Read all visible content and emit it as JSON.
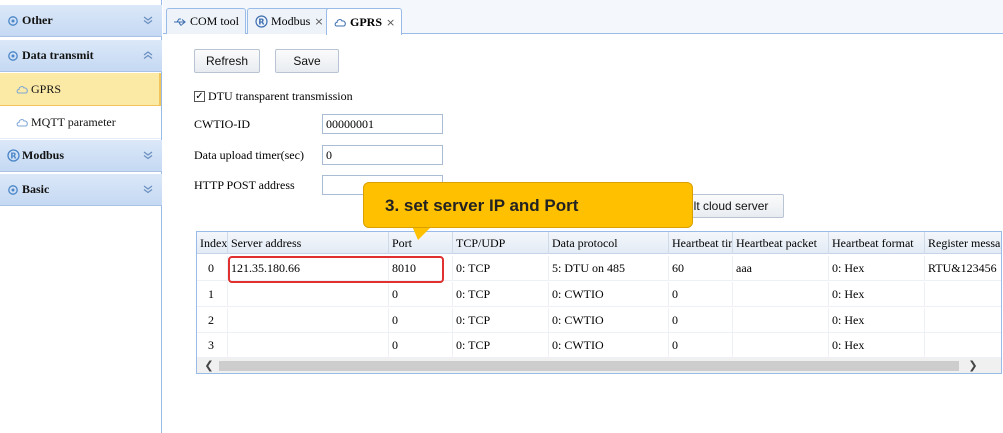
{
  "colors": {
    "sidebar_icon": "#4a86c8",
    "active_item": "#fbe9a6",
    "callout": "#ffc000",
    "highlight": "#e03030"
  },
  "sidebar": {
    "sections": [
      {
        "label": "Other",
        "icon": "gear-icon"
      },
      {
        "label": "Data transmit",
        "icon": "gear-icon"
      },
      {
        "label": "Modbus",
        "icon": "registered-icon"
      },
      {
        "label": "Basic",
        "icon": "gear-icon"
      }
    ],
    "items": [
      {
        "label": "GPRS",
        "icon": "cloud-icon",
        "active": true
      },
      {
        "label": "MQTT parameter",
        "icon": "cloud-icon",
        "active": false
      }
    ]
  },
  "tabs": [
    {
      "label": "COM tool",
      "icon": "usb-icon",
      "closable": false
    },
    {
      "label": "Modbus",
      "icon": "registered-icon",
      "closable": true
    },
    {
      "label": "GPRS",
      "icon": "cloud-icon",
      "closable": true,
      "active": true
    }
  ],
  "toolbar": {
    "refresh": "Refresh",
    "save": "Save",
    "default_cloud": "Default cloud server"
  },
  "form": {
    "transparent_label": "DTU transparent transmission",
    "transparent_checked": true,
    "cwtio_label": "CWTIO-ID",
    "cwtio_value": "00000001",
    "timer_label": "Data upload timer(sec)",
    "timer_value": "0",
    "http_label": "HTTP POST address",
    "http_value": ""
  },
  "grid": {
    "columns": [
      "Index",
      "Server address",
      "Port",
      "TCP/UDP",
      "Data protocol",
      "Heartbeat time",
      "Heartbeat packet",
      "Heartbeat format",
      "Register message"
    ],
    "rows": [
      [
        "0",
        "121.35.180.66",
        "8010",
        "0: TCP",
        "5: DTU on 485",
        "60",
        "aaa",
        "0: Hex",
        "RTU&123456"
      ],
      [
        "1",
        "",
        "0",
        "0: TCP",
        "0: CWTIO",
        "0",
        "",
        "0: Hex",
        ""
      ],
      [
        "2",
        "",
        "0",
        "0: TCP",
        "0: CWTIO",
        "0",
        "",
        "0: Hex",
        ""
      ],
      [
        "3",
        "",
        "0",
        "0: TCP",
        "0: CWTIO",
        "0",
        "",
        "0: Hex",
        ""
      ]
    ]
  },
  "annotation": {
    "text": "3. set server IP and Port"
  }
}
